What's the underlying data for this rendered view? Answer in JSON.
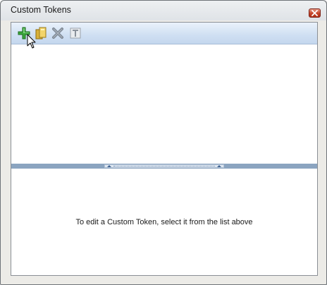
{
  "window": {
    "title": "Custom Tokens"
  },
  "toolbar": {
    "buttons": [
      {
        "icon": "add-icon",
        "tooltip": "Add"
      },
      {
        "icon": "folder-icon",
        "tooltip": "Open"
      },
      {
        "icon": "delete-icon",
        "tooltip": "Delete"
      },
      {
        "icon": "text-token-icon",
        "tooltip": "Rename"
      }
    ]
  },
  "editor": {
    "hint": "To edit a Custom Token, select it from the list above"
  },
  "colors": {
    "toolbar_gradient_top": "#eaf2fb",
    "toolbar_gradient_bottom": "#c4d7ee",
    "splitter": "#8ba4c0",
    "close_button": "#c54429"
  }
}
